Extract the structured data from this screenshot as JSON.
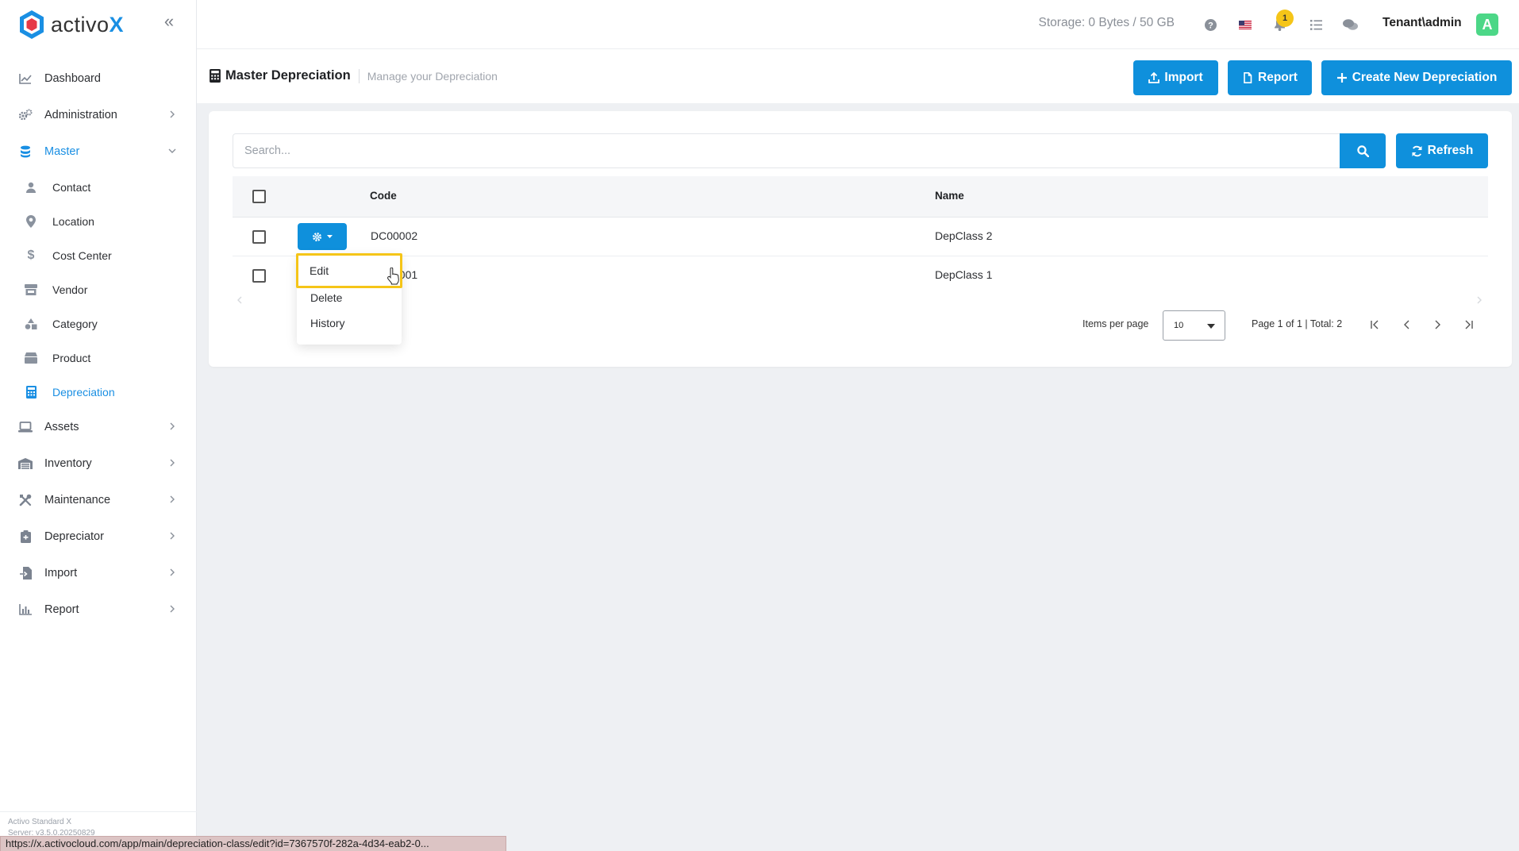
{
  "brand": {
    "name_prefix": "activo",
    "name_suffix": "X"
  },
  "sidebar": {
    "items": [
      {
        "label": "Dashboard",
        "icon": "chart-line-icon"
      },
      {
        "label": "Administration",
        "icon": "gears-icon",
        "chevron": "right"
      },
      {
        "label": "Master",
        "icon": "database-icon",
        "chevron": "down",
        "active": true
      },
      {
        "label": "Assets",
        "icon": "laptop-icon",
        "chevron": "right"
      },
      {
        "label": "Inventory",
        "icon": "warehouse-icon",
        "chevron": "right"
      },
      {
        "label": "Maintenance",
        "icon": "tools-icon",
        "chevron": "right"
      },
      {
        "label": "Depreciator",
        "icon": "clipboard-icon",
        "chevron": "right"
      },
      {
        "label": "Import",
        "icon": "file-import-icon",
        "chevron": "right"
      },
      {
        "label": "Report",
        "icon": "chart-bar-icon",
        "chevron": "right"
      }
    ],
    "master_sub": [
      {
        "label": "Contact",
        "icon": "user-icon"
      },
      {
        "label": "Location",
        "icon": "map-pin-icon"
      },
      {
        "label": "Cost Center",
        "icon": "dollar-icon"
      },
      {
        "label": "Vendor",
        "icon": "store-icon"
      },
      {
        "label": "Category",
        "icon": "shapes-icon"
      },
      {
        "label": "Product",
        "icon": "box-icon"
      },
      {
        "label": "Depreciation",
        "icon": "calculator-icon",
        "active": true
      }
    ],
    "footer_line1": "Activo Standard X",
    "footer_line2": "Server: v3.5.0.20250829"
  },
  "topbar": {
    "storage": "Storage: 0 Bytes / 50 GB",
    "notification_count": "1",
    "user": "Tenant\\admin",
    "avatar_letter": "A"
  },
  "page": {
    "title": "Master Depreciation",
    "subtitle": "Manage your Depreciation",
    "import_label": "Import",
    "report_label": "Report",
    "create_label": "Create New Depreciation"
  },
  "search": {
    "placeholder": "Search...",
    "value": ""
  },
  "refresh_label": "Refresh",
  "table": {
    "headers": {
      "code": "Code",
      "name": "Name"
    },
    "rows": [
      {
        "code": "DC00002",
        "name": "DepClass 2"
      },
      {
        "code": "DC00001",
        "name": "DepClass 1"
      }
    ]
  },
  "row_menu": {
    "edit": "Edit",
    "delete": "Delete",
    "history": "History"
  },
  "pager": {
    "items_per_page_label": "Items per page",
    "items_per_page": "10",
    "summary": "Page 1 of 1 | Total: 2"
  },
  "statusbar_url": "https://x.activocloud.com/app/main/depreciation-class/edit?id=7367570f-282a-4d34-eab2-0...",
  "colors": {
    "accent": "#0f90dc",
    "highlight": "#f5c518",
    "avatar": "#4cd787"
  }
}
